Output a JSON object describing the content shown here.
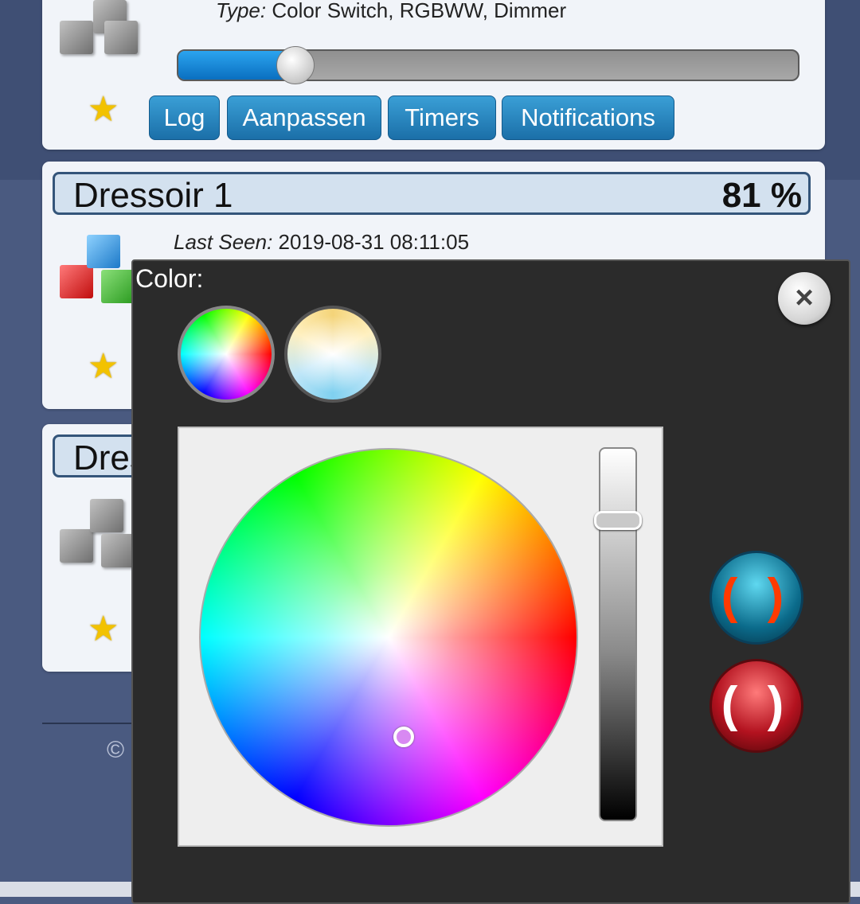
{
  "device1": {
    "type_label": "Type:",
    "type_value": " Color Switch, RGBWW, Dimmer",
    "slider_fraction": 0.16,
    "buttons": [
      "Log",
      "Aanpassen",
      "Timers",
      "Notifications"
    ]
  },
  "device2": {
    "name": "Dressoir 1",
    "level": "81 %",
    "last_seen_label": "Last Seen:",
    "last_seen_value": " 2019-08-31 08:11:05"
  },
  "device3": {
    "name_visible": "Dres"
  },
  "footer": {
    "copyright_symbol": "©"
  },
  "color_popup": {
    "title": "Color:",
    "close_icon": "×",
    "mode_rgb_icon": "color-wheel-icon",
    "mode_white_icon": "white-temperature-icon",
    "cancel_glyph": "( )",
    "ok_glyph": "( )"
  },
  "colors": {
    "accent_blue": "#1b6fa8",
    "popup_bg": "#2b2b2b"
  }
}
